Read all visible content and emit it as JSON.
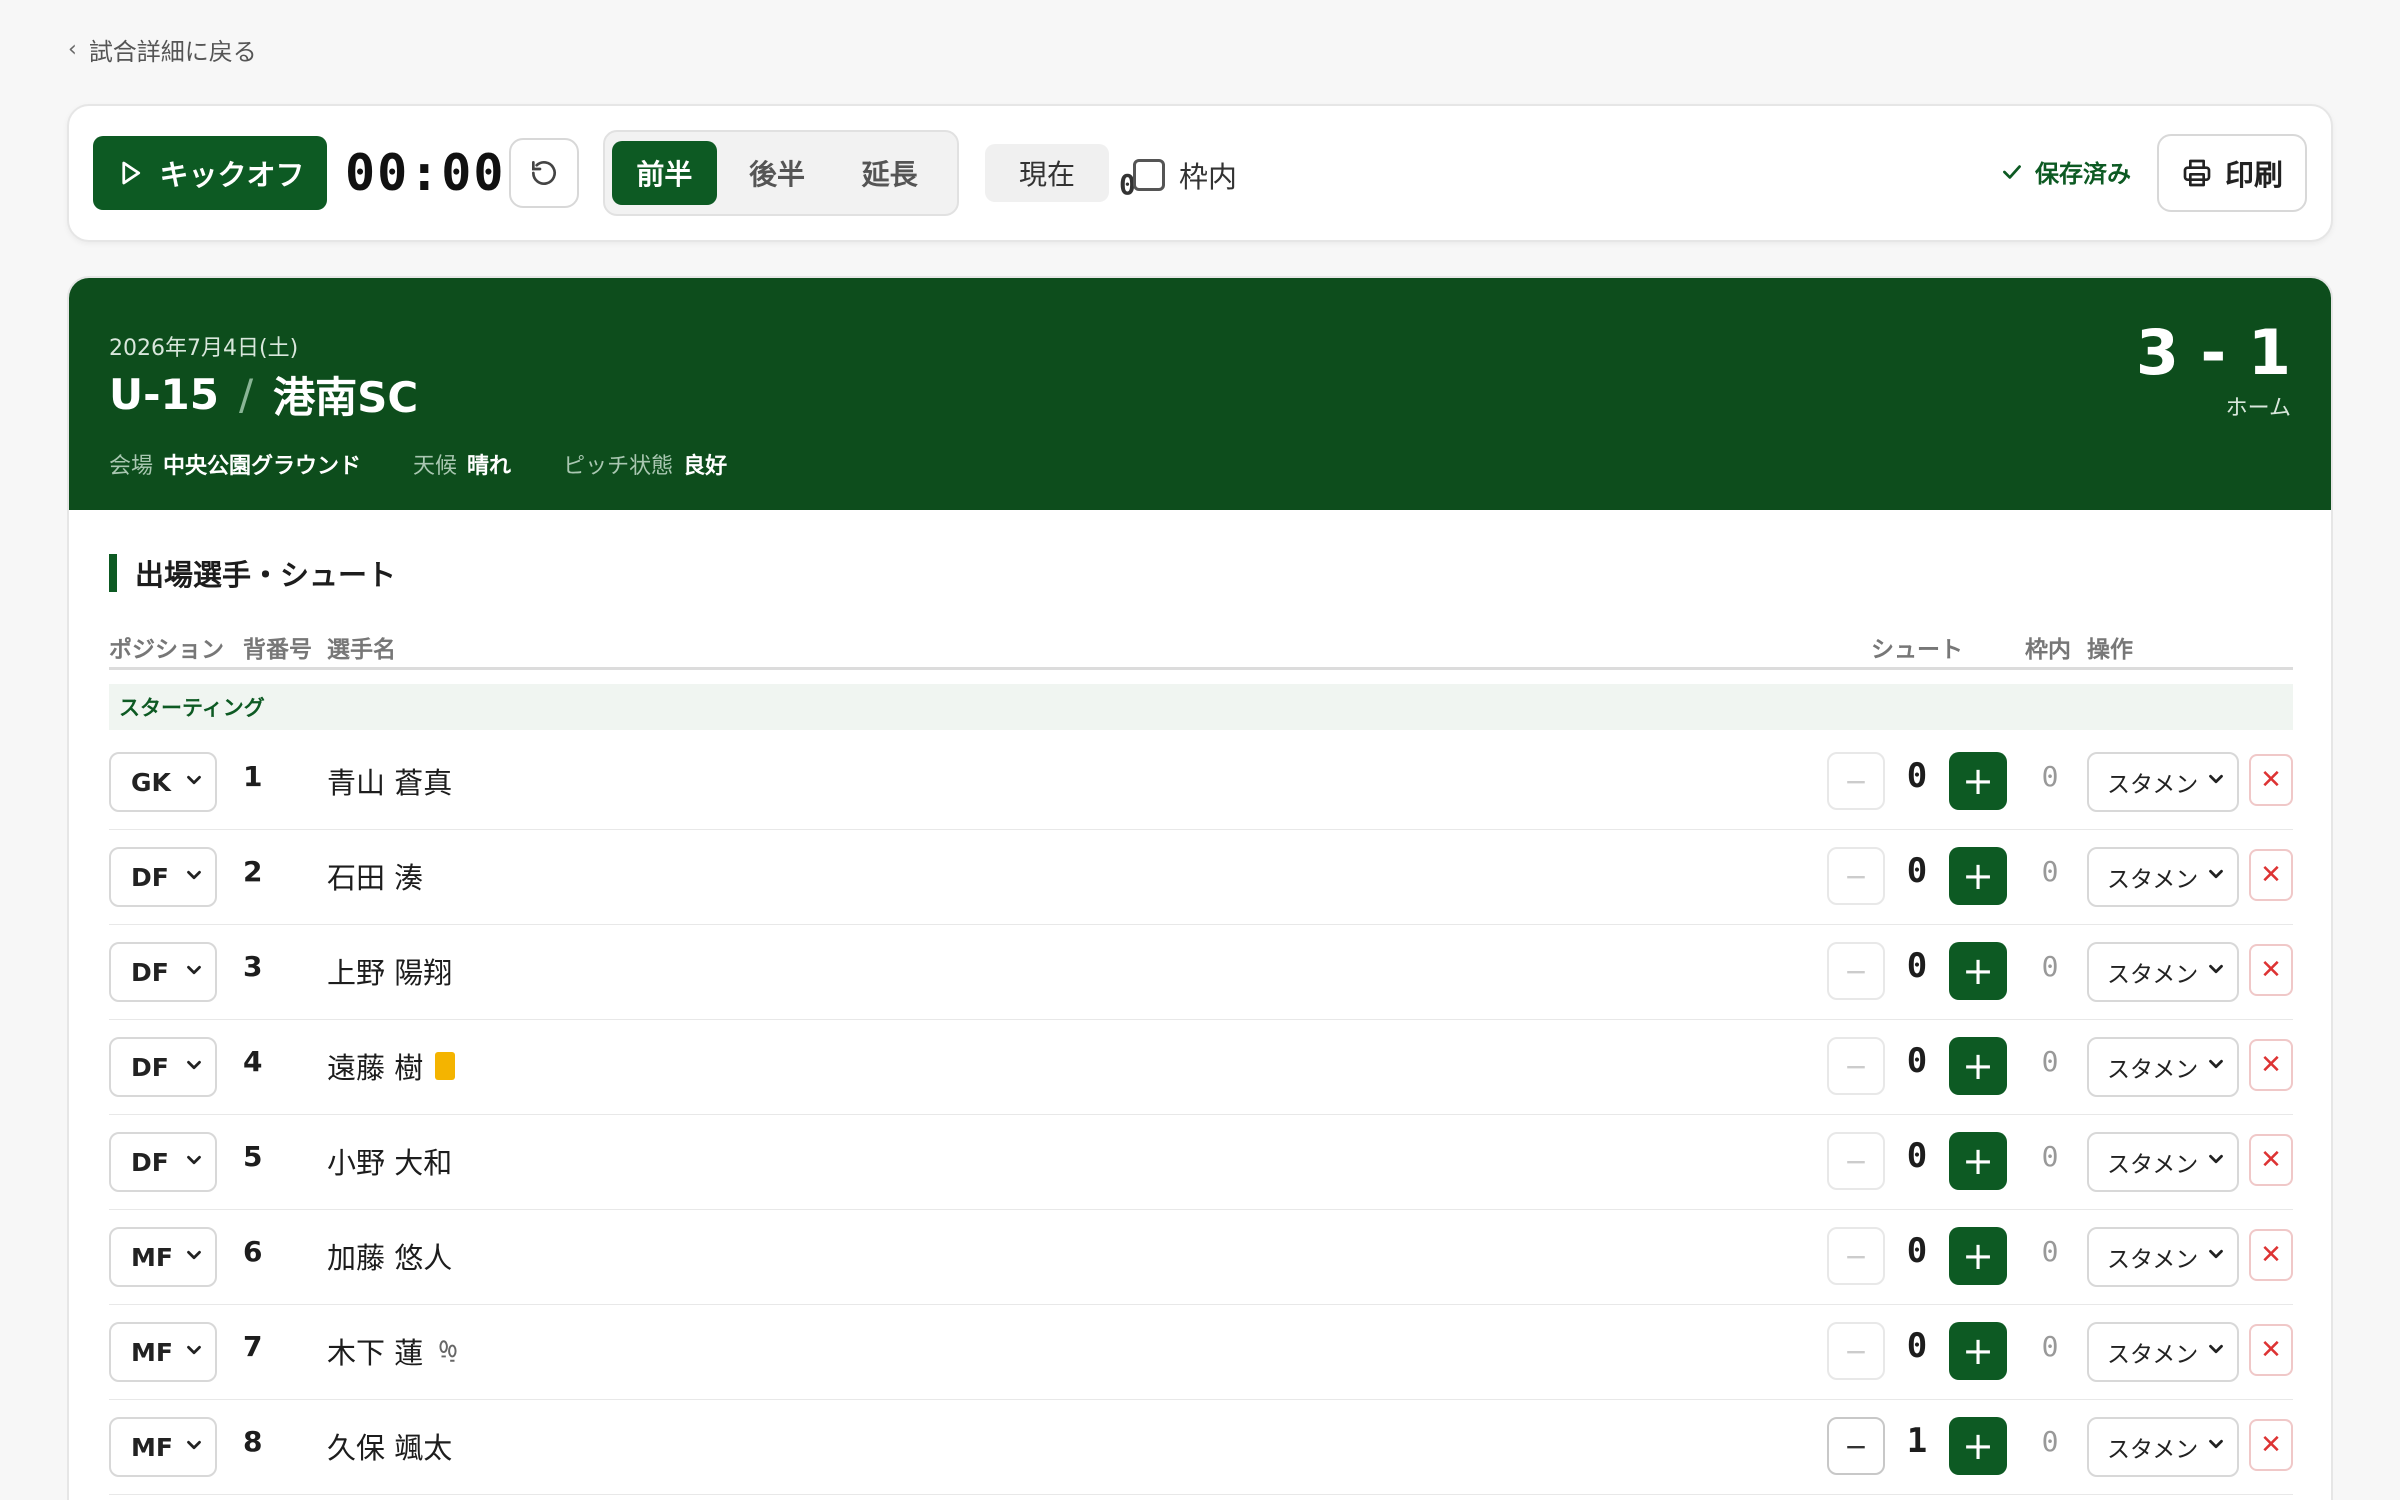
{
  "nav": {
    "back_label": "試合詳細に戻る"
  },
  "toolbar": {
    "kickoff_label": "キックオフ",
    "timer": "00:00",
    "periods": [
      "前半",
      "後半",
      "延長"
    ],
    "active_period": "前半",
    "current_label": "現在",
    "current_value": "0",
    "on_target_label": "枠内",
    "saved_label": "保存済み",
    "print_label": "印刷"
  },
  "match": {
    "date": "2026年7月4日(土)",
    "category": "U-15",
    "slash": "/",
    "opponent": "港南SC",
    "venue_label": "会場",
    "venue": "中央公園グラウンド",
    "weather_label": "天候",
    "weather": "晴れ",
    "pitch_label": "ピッチ状態",
    "pitch": "良好",
    "score": "3 - 1",
    "side": "ホーム"
  },
  "section": {
    "title": "出場選手・シュート",
    "columns": {
      "position": "ポジション",
      "number": "背番号",
      "name": "選手名",
      "shots": "シュート",
      "on_target": "枠内",
      "actions": "操作"
    },
    "group_label": "スターティング"
  },
  "players": [
    {
      "pos": "GK",
      "num": "1",
      "name": "青山 蒼真",
      "shots": "0",
      "on_target": "0",
      "status": "スタメン",
      "badge": ""
    },
    {
      "pos": "DF",
      "num": "2",
      "name": "石田 湊",
      "shots": "0",
      "on_target": "0",
      "status": "スタメン",
      "badge": ""
    },
    {
      "pos": "DF",
      "num": "3",
      "name": "上野 陽翔",
      "shots": "0",
      "on_target": "0",
      "status": "スタメン",
      "badge": ""
    },
    {
      "pos": "DF",
      "num": "4",
      "name": "遠藤 樹",
      "shots": "0",
      "on_target": "0",
      "status": "スタメン",
      "badge": "yellow-card"
    },
    {
      "pos": "DF",
      "num": "5",
      "name": "小野 大和",
      "shots": "0",
      "on_target": "0",
      "status": "スタメン",
      "badge": ""
    },
    {
      "pos": "MF",
      "num": "6",
      "name": "加藤 悠人",
      "shots": "0",
      "on_target": "0",
      "status": "スタメン",
      "badge": ""
    },
    {
      "pos": "MF",
      "num": "7",
      "name": "木下 蓮",
      "shots": "0",
      "on_target": "0",
      "status": "スタメン",
      "badge": "footprints-icon"
    },
    {
      "pos": "MF",
      "num": "8",
      "name": "久保 颯太",
      "shots": "1",
      "on_target": "0",
      "status": "スタメン",
      "badge": ""
    }
  ],
  "colors": {
    "brand": "#0d5a23",
    "header_bg": "#0d4d1c",
    "yellow_card": "#f4b400",
    "delete": "#dd3333"
  }
}
